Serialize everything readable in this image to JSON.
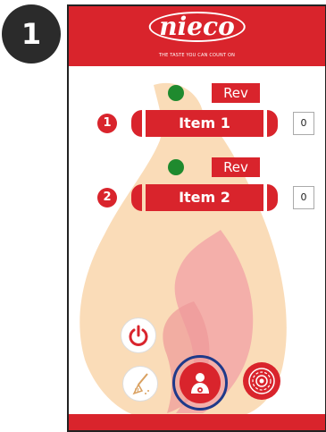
{
  "step": {
    "number": "1"
  },
  "header": {
    "logo_text": "nieco",
    "tagline": "THE TASTE YOU CAN COUNT ON"
  },
  "items": [
    {
      "index": "1",
      "label": "Item 1",
      "rev_label": "Rev",
      "count": "0",
      "status_color": "#1f8a2e"
    },
    {
      "index": "2",
      "label": "Item 2",
      "rev_label": "Rev",
      "count": "0",
      "status_color": "#1f8a2e"
    }
  ],
  "toolbar": {
    "icons": [
      "power-icon",
      "broom-icon",
      "person-gear-icon",
      "gear-icon"
    ],
    "highlighted": "person-gear-icon"
  },
  "colors": {
    "brand_red": "#d9242c",
    "status_green": "#1f8a2e",
    "highlight_blue": "#1f3a8a"
  }
}
